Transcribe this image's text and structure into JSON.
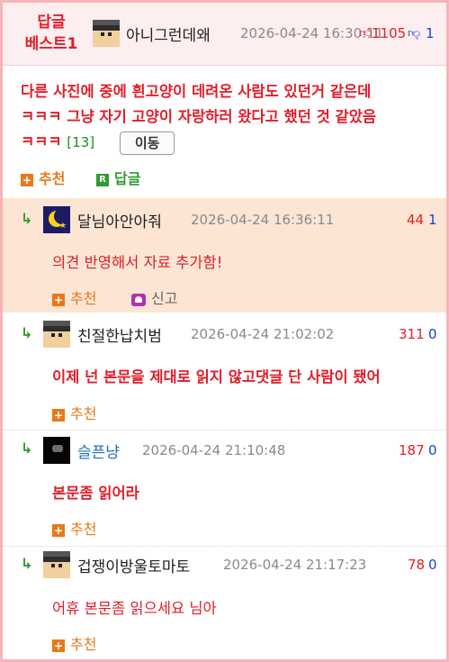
{
  "best": {
    "badge_line1": "답글",
    "badge_line2": "베스트1",
    "nickname": "아니그런데왜",
    "date": "2026-04-24 16:30:11",
    "up": "1105",
    "down": "1",
    "body_line1": "다른 사진에 중에 흰고양이 데려온 사람도 있던거 같은데",
    "body_line2": "ㅋㅋㅋ 그냥 자기 고양이 자랑하러 왔다고 했던 것 같았음",
    "body_line3": "ㅋㅋㅋ",
    "comment_count": "[13]",
    "move_label": "이동",
    "recommend_label": "추천",
    "reply_label": "답글",
    "colors": {
      "accent": "#e01f2a",
      "header_bg": "#fdeef0",
      "border": "#f5b5b9"
    }
  },
  "replies": [
    {
      "arrow": "↳",
      "avatar": "moon-avatar",
      "nickname": "달님아안아줘",
      "date": "2026-04-24 16:36:11",
      "up": "44",
      "down": "1",
      "body": "의견 반영해서 자료 추가함!",
      "recommend_label": "추천",
      "report_label": "신고",
      "highlighted": true
    },
    {
      "arrow": "↳",
      "avatar": "face-avatar",
      "nickname": "친절한납치범",
      "date": "2026-04-24 21:02:02",
      "up": "311",
      "down": "0",
      "body": "이제 넌 본문을 제대로 읽지 않고댓글 단 사람이 됐어",
      "recommend_label": "추천"
    },
    {
      "arrow": "↳",
      "avatar": "dark-avatar",
      "nickname": "슬픈냥",
      "date": "2026-04-24 21:10:48",
      "up": "187",
      "down": "0",
      "body": "본문좀 읽어라",
      "recommend_label": "추천"
    },
    {
      "arrow": "↳",
      "avatar": "face-avatar",
      "nickname": "겁쟁이방울토마토",
      "date": "2026-04-24 21:17:23",
      "up": "78",
      "down": "0",
      "body": "어휴 본문좀 읽으세요 님아",
      "recommend_label": "추천"
    }
  ]
}
